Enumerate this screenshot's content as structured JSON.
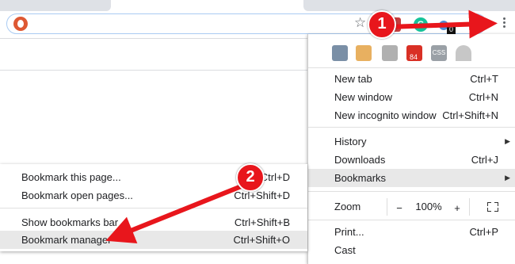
{
  "extensions": {
    "badge_count": "0",
    "badge_count_menu": "84",
    "css_label": "CSS"
  },
  "menu": {
    "items": [
      {
        "label": "New tab",
        "shortcut": "Ctrl+T"
      },
      {
        "label": "New window",
        "shortcut": "Ctrl+N"
      },
      {
        "label": "New incognito window",
        "shortcut": "Ctrl+Shift+N"
      },
      {
        "label": "History",
        "shortcut": ""
      },
      {
        "label": "Downloads",
        "shortcut": "Ctrl+J"
      },
      {
        "label": "Bookmarks",
        "shortcut": ""
      }
    ],
    "zoom": {
      "label": "Zoom",
      "minus": "−",
      "value": "100%",
      "plus": "+"
    },
    "print": {
      "label": "Print...",
      "shortcut": "Ctrl+P"
    },
    "cast": {
      "label": "Cast"
    }
  },
  "bookmarks_submenu": {
    "items": [
      {
        "label": "Bookmark this page...",
        "shortcut": "Ctrl+D"
      },
      {
        "label": "Bookmark open pages...",
        "shortcut": "Ctrl+Shift+D"
      },
      {
        "label": "Show bookmarks bar",
        "shortcut": "Ctrl+Shift+B"
      },
      {
        "label": "Bookmark manager",
        "shortcut": "Ctrl+Shift+O"
      }
    ]
  },
  "annotations": {
    "step1": "1",
    "step2": "2"
  },
  "colors": {
    "annotation_red": "#e8161c",
    "highlight": "#e8e8e8",
    "omnibox_border": "#aacbf3"
  }
}
